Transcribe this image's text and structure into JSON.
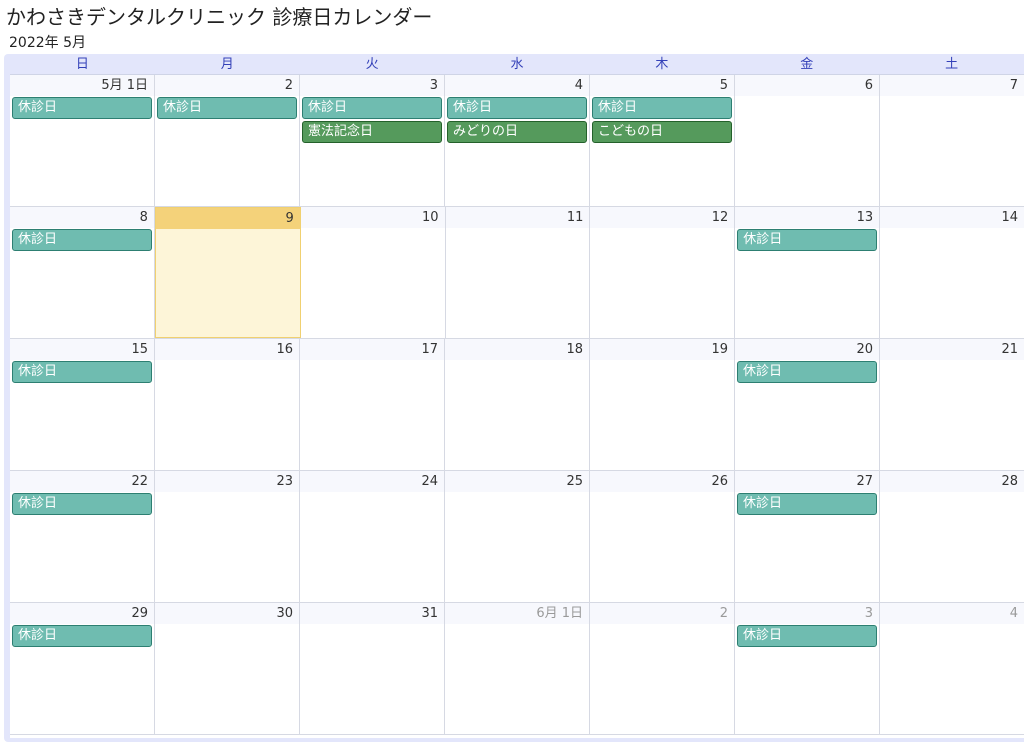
{
  "title": "かわさきデンタルクリニック 診療日カレンダー",
  "month_label": "2022年 5月",
  "weekdays": [
    "日",
    "月",
    "火",
    "水",
    "木",
    "金",
    "土"
  ],
  "colors": {
    "closed": "#6fbcb0",
    "holiday": "#559a5c",
    "today": "#f4d27a",
    "header_text": "#3340b8"
  },
  "weeks": [
    {
      "days": [
        {
          "label": "5月 1日",
          "events": [
            {
              "text": "休診日",
              "kind": "closed"
            }
          ]
        },
        {
          "label": "2",
          "events": [
            {
              "text": "休診日",
              "kind": "closed"
            }
          ]
        },
        {
          "label": "3",
          "events": [
            {
              "text": "休診日",
              "kind": "closed"
            },
            {
              "text": "憲法記念日",
              "kind": "holiday"
            }
          ]
        },
        {
          "label": "4",
          "events": [
            {
              "text": "休診日",
              "kind": "closed"
            },
            {
              "text": "みどりの日",
              "kind": "holiday"
            }
          ]
        },
        {
          "label": "5",
          "events": [
            {
              "text": "休診日",
              "kind": "closed"
            },
            {
              "text": "こどもの日",
              "kind": "holiday"
            }
          ]
        },
        {
          "label": "6",
          "events": []
        },
        {
          "label": "7",
          "events": []
        }
      ]
    },
    {
      "days": [
        {
          "label": "8",
          "events": [
            {
              "text": "休診日",
              "kind": "closed"
            }
          ]
        },
        {
          "label": "9",
          "today": true,
          "events": []
        },
        {
          "label": "10",
          "events": []
        },
        {
          "label": "11",
          "events": []
        },
        {
          "label": "12",
          "events": []
        },
        {
          "label": "13",
          "events": [
            {
              "text": "休診日",
              "kind": "closed"
            }
          ]
        },
        {
          "label": "14",
          "events": []
        }
      ]
    },
    {
      "days": [
        {
          "label": "15",
          "events": [
            {
              "text": "休診日",
              "kind": "closed"
            }
          ]
        },
        {
          "label": "16",
          "events": []
        },
        {
          "label": "17",
          "events": []
        },
        {
          "label": "18",
          "events": []
        },
        {
          "label": "19",
          "events": []
        },
        {
          "label": "20",
          "events": [
            {
              "text": "休診日",
              "kind": "closed"
            }
          ]
        },
        {
          "label": "21",
          "events": []
        }
      ]
    },
    {
      "days": [
        {
          "label": "22",
          "events": [
            {
              "text": "休診日",
              "kind": "closed"
            }
          ]
        },
        {
          "label": "23",
          "events": []
        },
        {
          "label": "24",
          "events": []
        },
        {
          "label": "25",
          "events": []
        },
        {
          "label": "26",
          "events": []
        },
        {
          "label": "27",
          "events": [
            {
              "text": "休診日",
              "kind": "closed"
            }
          ]
        },
        {
          "label": "28",
          "events": []
        }
      ]
    },
    {
      "days": [
        {
          "label": "29",
          "events": [
            {
              "text": "休診日",
              "kind": "closed"
            }
          ]
        },
        {
          "label": "30",
          "events": []
        },
        {
          "label": "31",
          "events": []
        },
        {
          "label": "6月 1日",
          "other_month": true,
          "events": []
        },
        {
          "label": "2",
          "other_month": true,
          "events": []
        },
        {
          "label": "3",
          "other_month": true,
          "events": [
            {
              "text": "休診日",
              "kind": "closed"
            }
          ]
        },
        {
          "label": "4",
          "other_month": true,
          "events": []
        }
      ]
    }
  ]
}
